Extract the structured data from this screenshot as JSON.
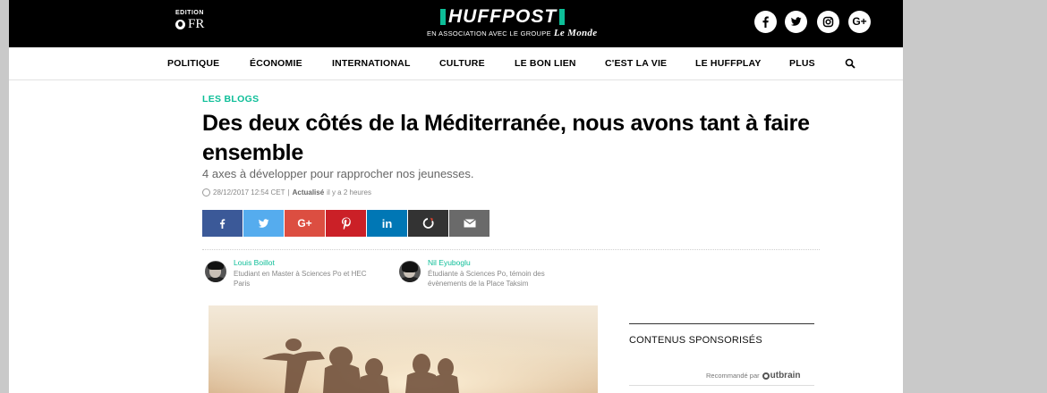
{
  "header": {
    "edition_label": "EDITION",
    "edition_value": "FR",
    "logo_text": "HUFFPOST",
    "association_text": "EN ASSOCIATION AVEC LE GROUPE",
    "partner_name": "Le Monde",
    "social": [
      "facebook-icon",
      "twitter-icon",
      "instagram-icon",
      "google-plus-icon"
    ],
    "accent_color": "#0dbe98"
  },
  "nav": {
    "items": [
      "POLITIQUE",
      "ÉCONOMIE",
      "INTERNATIONAL",
      "CULTURE",
      "LE BON LIEN",
      "C'EST LA VIE",
      "LE HUFFPLAY",
      "PLUS"
    ]
  },
  "article": {
    "section": "LES BLOGS",
    "title": "Des deux côtés de la Méditerranée, nous avons tant à faire ensemble",
    "subtitle": "4 axes à développer pour rapprocher nos jeunesses.",
    "date": "28/12/2017 12:54 CET",
    "separator": "|",
    "updated_label": "Actualisé",
    "updated_ago": "il y a 2 heures",
    "share_buttons": [
      {
        "name": "facebook-share",
        "glyph": "f",
        "color": "#3b5998"
      },
      {
        "name": "twitter-share",
        "glyph": "t",
        "color": "#55acee"
      },
      {
        "name": "googleplus-share",
        "glyph": "G+",
        "color": "#dc4e41"
      },
      {
        "name": "pinterest-share",
        "glyph": "p",
        "color": "#cb2027"
      },
      {
        "name": "linkedin-share",
        "glyph": "in",
        "color": "#0077b5"
      },
      {
        "name": "refresh-share",
        "glyph": "o",
        "color": "#333333"
      },
      {
        "name": "email-share",
        "glyph": "mail",
        "color": "#6a6a6a"
      }
    ],
    "authors": [
      {
        "name": "Louis Boillot",
        "bio": "Etudiant en Master à Sciences Po et HEC Paris"
      },
      {
        "name": "Nil Eyuboglu",
        "bio": "Étudiante à Sciences Po, témoin des évènements de la Place Taksim"
      }
    ]
  },
  "sidebar": {
    "sponsored_title": "CONTENUS SPONSORISÉS",
    "recommended_label": "Recommandé par",
    "recommender": "utbrain"
  }
}
